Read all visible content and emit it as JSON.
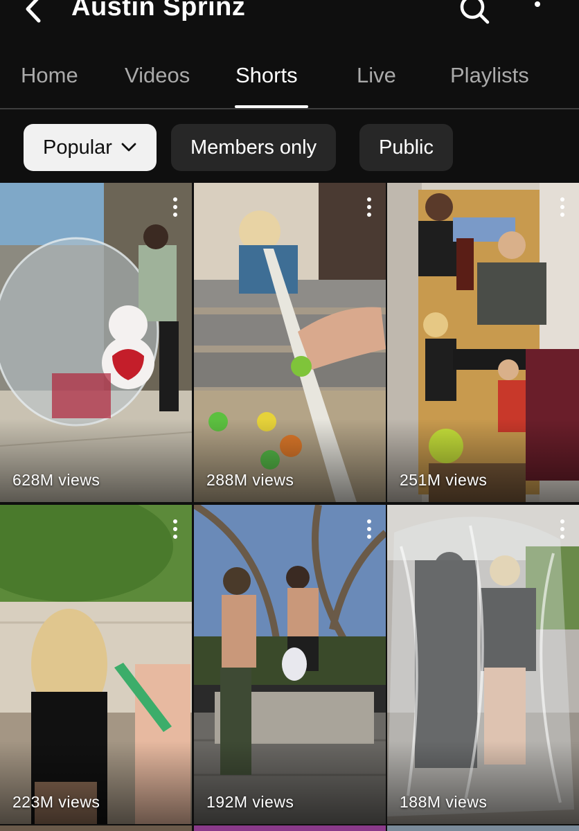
{
  "header": {
    "title": "Austin Sprinz",
    "back_icon": "arrow-back-icon",
    "search_icon": "search-icon",
    "more_icon": "more-vert-icon"
  },
  "tabs": [
    {
      "label": "Home"
    },
    {
      "label": "Videos"
    },
    {
      "label": "Shorts",
      "active": true
    },
    {
      "label": "Live"
    },
    {
      "label": "Playlists"
    }
  ],
  "filters": [
    {
      "label": "Popular",
      "selected": true
    },
    {
      "label": "Members only"
    },
    {
      "label": "Public"
    }
  ],
  "shorts": [
    {
      "views": "628M views"
    },
    {
      "views": "288M views"
    },
    {
      "views": "251M views"
    },
    {
      "views": "223M views"
    },
    {
      "views": "192M views"
    },
    {
      "views": "188M views"
    }
  ],
  "colors": {
    "background": "#0f0f0f",
    "chip": "#272727",
    "chip_selected": "#f1f1f1",
    "inactive_tab": "#aaaaaa"
  }
}
